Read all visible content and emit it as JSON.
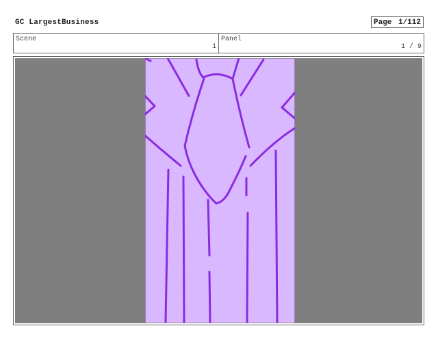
{
  "header": {
    "title": "GC LargestBusiness",
    "page_label": "Page",
    "page_value": "1/112"
  },
  "info": {
    "scene_label": "Scene",
    "scene_value": "1",
    "panel_label": "Panel",
    "panel_value": "1 / 9"
  },
  "colors": {
    "canvas_bg": "#7f7f7f",
    "drawing_fill": "#d9b8ff",
    "drawing_stroke": "#8a2be2"
  }
}
